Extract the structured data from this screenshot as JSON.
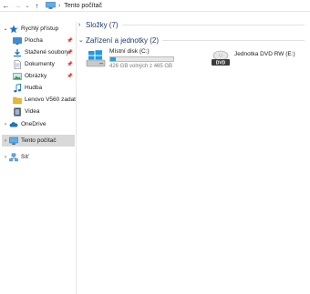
{
  "address_bar": {
    "back_icon": "arrow-left-icon",
    "forward_icon": "arrow-right-icon",
    "recent_icon": "chevron-down-icon",
    "up_icon": "arrow-up-icon",
    "location_icon": "computer-icon",
    "separator": "›",
    "breadcrumb": "Tento počítač"
  },
  "sidebar": {
    "quick_access": {
      "label": "Rychlý přístup",
      "expanded": true,
      "items": [
        {
          "label": "Plocha",
          "icon": "desktop-icon",
          "pinned": true
        },
        {
          "label": "Stažené soubory",
          "icon": "downloads-icon",
          "pinned": true
        },
        {
          "label": "Dokumenty",
          "icon": "documents-icon",
          "pinned": true
        },
        {
          "label": "Obrázky",
          "icon": "pictures-icon",
          "pinned": true
        },
        {
          "label": "Hudba",
          "icon": "music-icon",
          "pinned": false
        },
        {
          "label": "Lenovo V560 zadat",
          "icon": "folder-icon",
          "pinned": false
        },
        {
          "label": "Videa",
          "icon": "videos-icon",
          "pinned": false
        }
      ]
    },
    "onedrive": {
      "label": "OneDrive",
      "icon": "cloud-icon"
    },
    "this_pc": {
      "label": "Tento počítač",
      "icon": "computer-icon",
      "selected": true
    },
    "network": {
      "label": "Síť",
      "icon": "network-icon"
    },
    "pin_glyph": "📌"
  },
  "main": {
    "groups": [
      {
        "title": "Složky (7)",
        "collapsed": true
      },
      {
        "title": "Zařízení a jednotky (2)",
        "collapsed": false
      }
    ],
    "drives": [
      {
        "name": "Místní disk (C:)",
        "icon": "windows-drive-icon",
        "free_text": "426 GB volných z 465 GB",
        "used_fraction": 0.084
      },
      {
        "name": "Jednotka DVD RW (E:)",
        "icon": "dvd-drive-icon",
        "badge": "DVD"
      }
    ]
  },
  "colors": {
    "selection": "#d9d9d9",
    "usage_bar": "#26a0da",
    "group_title": "#1f3a6b",
    "quick_access_star": "#1e73be",
    "folder": "#e8b839"
  }
}
